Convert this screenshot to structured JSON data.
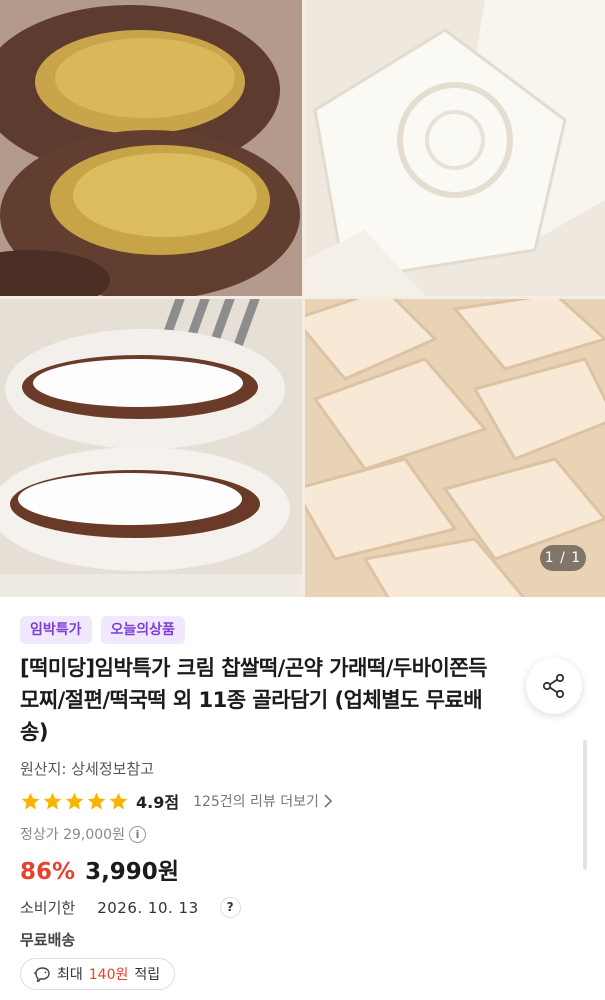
{
  "gallery": {
    "counter": "1 / 1",
    "images": [
      "hotteok-rice-cake",
      "jeolpyeon-rice-cake",
      "cream-glutinous-rice-cake",
      "tteokguk-rice-cake"
    ]
  },
  "badges": [
    "임박특가",
    "오늘의상품"
  ],
  "product": {
    "title": "[떡미당]임박특가 크림 찹쌀떡/곤약 가래떡/두바이쫀득모찌/절편/떡국떡 외 11종 골라담기 (업체별도 무료배송)",
    "origin": "원산지: 상세정보참고",
    "rating": "4.9점",
    "reviews": "125건의 리뷰 더보기",
    "regular_price": "정상가 29,000원",
    "discount": "86%",
    "price": "3,990원",
    "expiry_label": "소비기한",
    "expiry_date": "2026. 10. 13",
    "expiry_help": "?",
    "shipping": "무료배송",
    "points_prefix": "최대",
    "points_value": "140원",
    "points_suffix": "적립"
  },
  "colors": {
    "accent_purple": "#7c3fd6",
    "discount_red": "#e8412c",
    "star_yellow": "#f7b500"
  },
  "icons": {
    "share": "share-icon",
    "star": "star-icon",
    "info": "info-icon",
    "chevron": "chevron-right-icon",
    "help": "question-icon",
    "points": "piggy-bank-icon"
  }
}
